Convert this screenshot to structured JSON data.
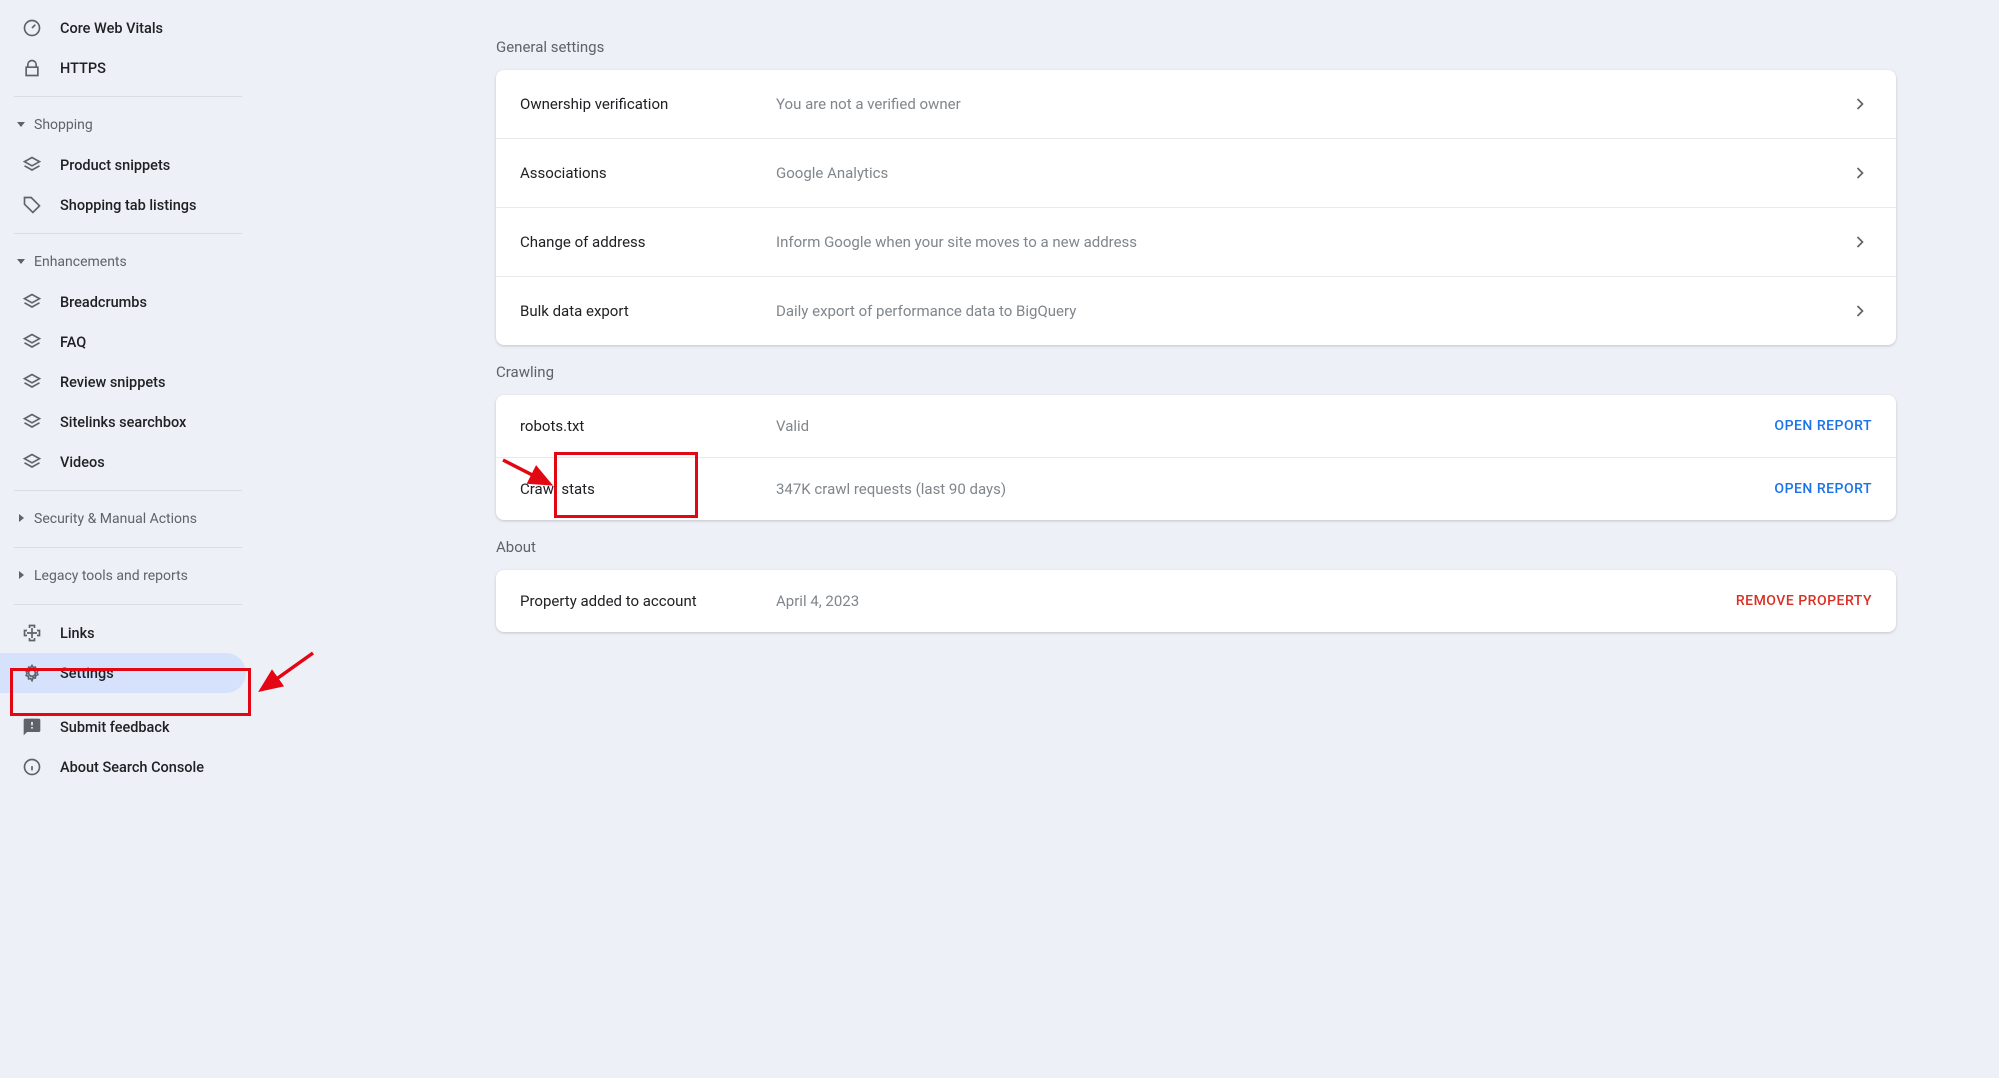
{
  "sidebar": {
    "items_top": [
      {
        "label": "Core Web Vitals",
        "icon": "gauge"
      },
      {
        "label": "HTTPS",
        "icon": "lock"
      }
    ],
    "shopping": {
      "header": "Shopping",
      "items": [
        {
          "label": "Product snippets",
          "icon": "layers"
        },
        {
          "label": "Shopping tab listings",
          "icon": "tag"
        }
      ]
    },
    "enhancements": {
      "header": "Enhancements",
      "items": [
        {
          "label": "Breadcrumbs",
          "icon": "layers"
        },
        {
          "label": "FAQ",
          "icon": "layers"
        },
        {
          "label": "Review snippets",
          "icon": "layers"
        },
        {
          "label": "Sitelinks searchbox",
          "icon": "layers"
        },
        {
          "label": "Videos",
          "icon": "layers"
        }
      ]
    },
    "security_header": "Security & Manual Actions",
    "legacy_header": "Legacy tools and reports",
    "items_bottom": [
      {
        "label": "Links",
        "icon": "links"
      },
      {
        "label": "Settings",
        "icon": "gear",
        "selected": true
      },
      {
        "label": "Submit feedback",
        "icon": "feedback"
      },
      {
        "label": "About Search Console",
        "icon": "info"
      }
    ]
  },
  "main": {
    "general": {
      "label": "General settings",
      "rows": [
        {
          "title": "Ownership verification",
          "desc": "You are not a verified owner"
        },
        {
          "title": "Associations",
          "desc": "Google Analytics"
        },
        {
          "title": "Change of address",
          "desc": "Inform Google when your site moves to a new address"
        },
        {
          "title": "Bulk data export",
          "desc": "Daily export of performance data to BigQuery"
        }
      ]
    },
    "crawling": {
      "label": "Crawling",
      "rows": [
        {
          "title": "robots.txt",
          "desc": "Valid",
          "action": "OPEN REPORT"
        },
        {
          "title": "Crawl stats",
          "desc": "347K crawl requests (last 90 days)",
          "action": "OPEN REPORT"
        }
      ]
    },
    "about": {
      "label": "About",
      "rows": [
        {
          "title": "Property added to account",
          "desc": "April 4, 2023",
          "action": "REMOVE PROPERTY",
          "danger": true
        }
      ]
    }
  }
}
